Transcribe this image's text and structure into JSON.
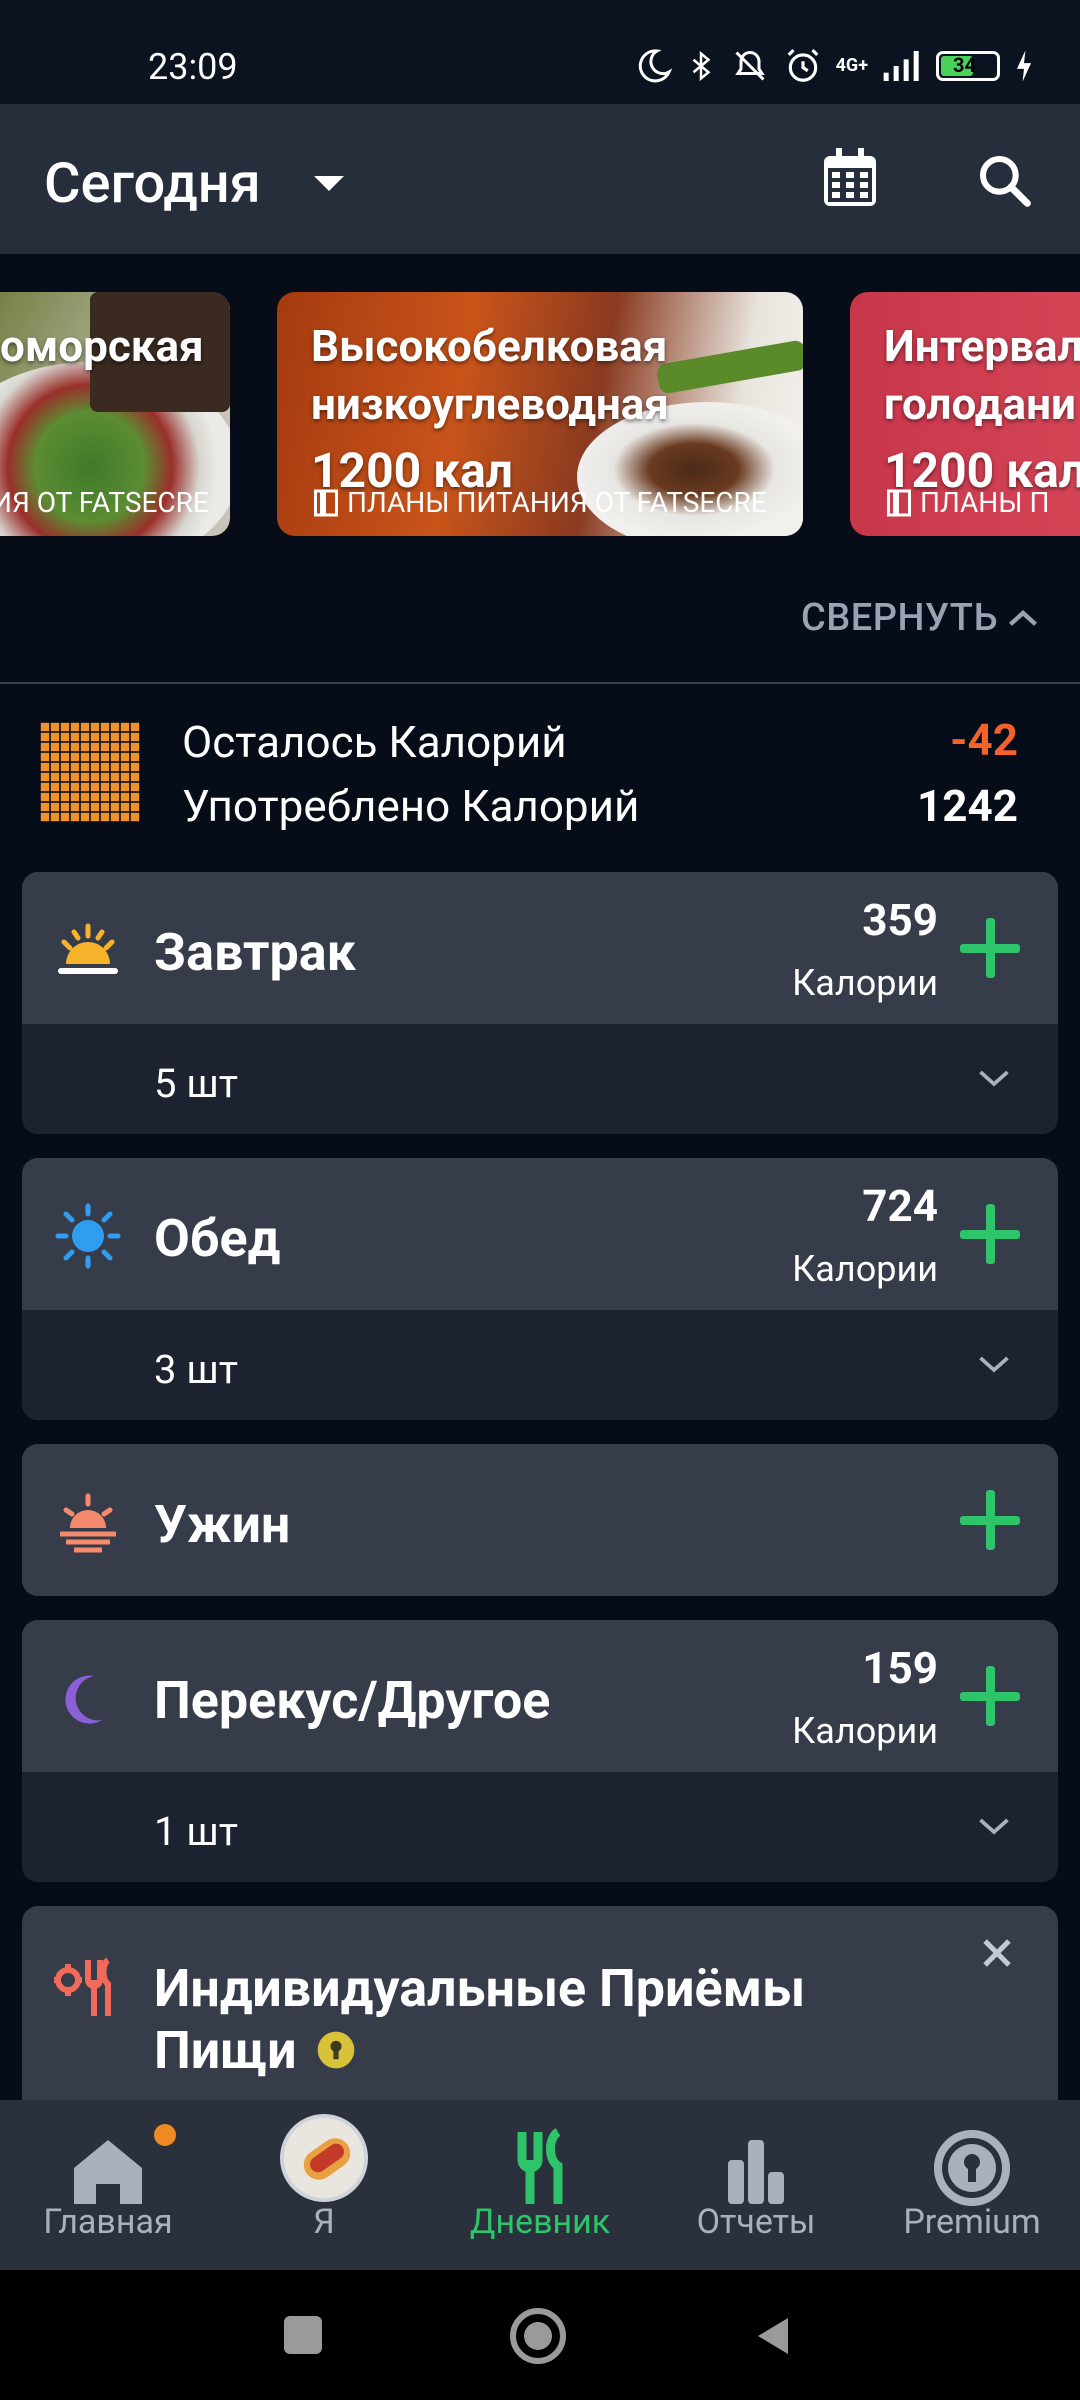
{
  "status": {
    "time": "23:09",
    "battery": "34",
    "network": "4G+"
  },
  "header": {
    "title": "Сегодня"
  },
  "carousel": [
    {
      "line1": "оморская",
      "line2": "",
      "line3": "",
      "sub": "ИЯ ОТ FATSECRE"
    },
    {
      "line1": "Высокобелковая",
      "line2": "низкоуглеводная",
      "line3": "1200 кал",
      "sub": "ПЛАНЫ ПИТАНИЯ ОТ FATSECRE"
    },
    {
      "line1": "Интервал",
      "line2": "голодани",
      "line3": "1200 кал",
      "sub": "ПЛАНЫ П"
    }
  ],
  "collapse_label": "СВЕРНУТЬ",
  "summary": {
    "remaining_label": "Осталось Калорий",
    "remaining_value": "-42",
    "consumed_label": "Употреблено Калорий",
    "consumed_value": "1242"
  },
  "meals": [
    {
      "name": "Завтрак",
      "calories": "359",
      "cal_label": "Калории",
      "count": "5 шт"
    },
    {
      "name": "Обед",
      "calories": "724",
      "cal_label": "Калории",
      "count": "3 шт"
    },
    {
      "name": "Ужин"
    },
    {
      "name": "Перекус/Другое",
      "calories": "159",
      "cal_label": "Калории",
      "count": "1 шт"
    }
  ],
  "custom_meals": {
    "line1": "Индивидуальные Приёмы",
    "line2": "Пищи"
  },
  "nav": [
    {
      "label": "Главная"
    },
    {
      "label": "Я"
    },
    {
      "label": "Дневник"
    },
    {
      "label": "Отчеты"
    },
    {
      "label": "Premium"
    }
  ],
  "colors": {
    "accent_green": "#2ec46a",
    "negative": "#f2622a",
    "orange": "#f0922c"
  }
}
